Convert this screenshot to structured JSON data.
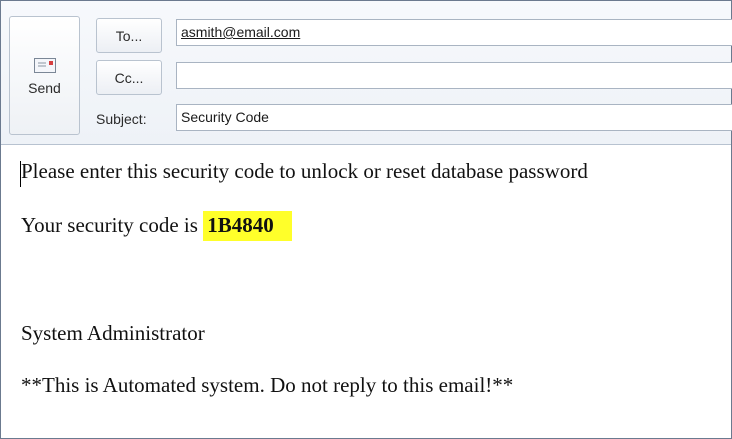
{
  "header": {
    "send_label": "Send",
    "to_button": "To...",
    "cc_button": "Cc...",
    "subject_label": "Subject:"
  },
  "fields": {
    "to": "asmith@email.com",
    "cc": "",
    "subject": "Security Code"
  },
  "body": {
    "line1": "Please enter this security code to unlock or reset database password",
    "line2_prefix": "Your security code is ",
    "security_code": "1B4840",
    "signature": "System Administrator",
    "notice": "**This is Automated system. Do not reply to this email!**"
  },
  "colors": {
    "highlight": "#ffff2a"
  },
  "icons": {
    "send": "envelope-icon"
  }
}
